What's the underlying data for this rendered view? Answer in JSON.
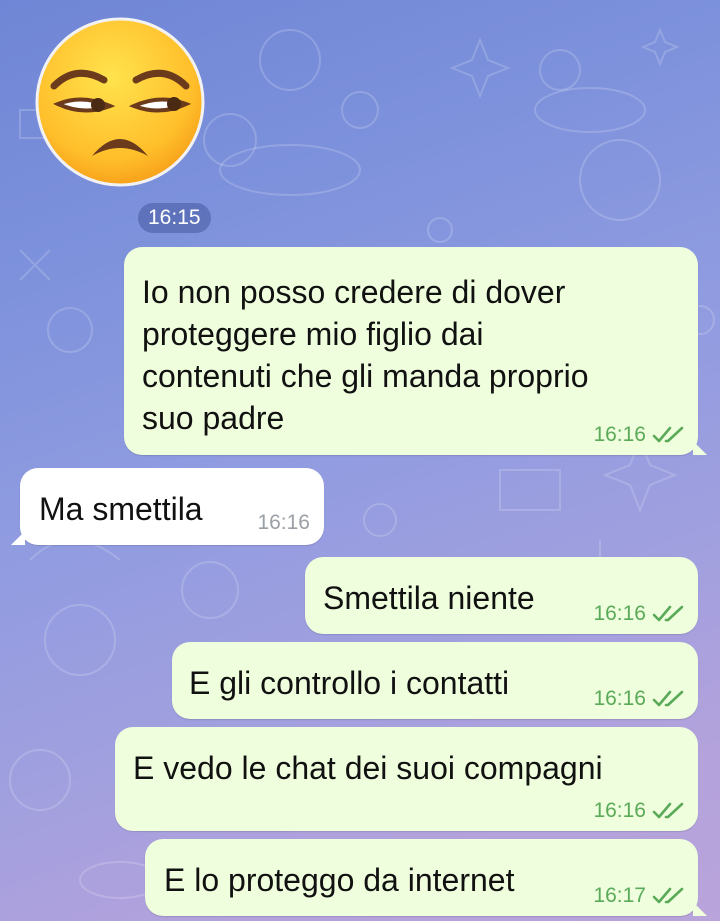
{
  "conversation": {
    "sticker": {
      "emoji": "😒",
      "time": "16:15"
    },
    "messages": [
      {
        "direction": "out",
        "text": "Io non posso credere di dover\nproteggere mio figlio dai\ncontenuti che gli manda proprio\nsuo padre",
        "time": "16:16",
        "status": "read"
      },
      {
        "direction": "in",
        "text": "Ma smettila",
        "time": "16:16"
      },
      {
        "direction": "out",
        "text": "Smettila niente",
        "time": "16:16",
        "status": "read"
      },
      {
        "direction": "out",
        "text": "E gli controllo i contatti",
        "time": "16:16",
        "status": "read"
      },
      {
        "direction": "out",
        "text": "E vedo le chat dei suoi compagni",
        "time": "16:16",
        "status": "read"
      },
      {
        "direction": "out",
        "text": "E lo proteggo da internet",
        "time": "16:17",
        "status": "read"
      }
    ]
  },
  "colors": {
    "outgoing_bubble": "#effedd",
    "incoming_bubble": "#ffffff",
    "read_check": "#5aaa59",
    "background_start": "#6f86d6",
    "background_end": "#b9a4db"
  },
  "icons": {
    "read_status": "double-check-icon",
    "sticker": "unamused-face-icon"
  }
}
